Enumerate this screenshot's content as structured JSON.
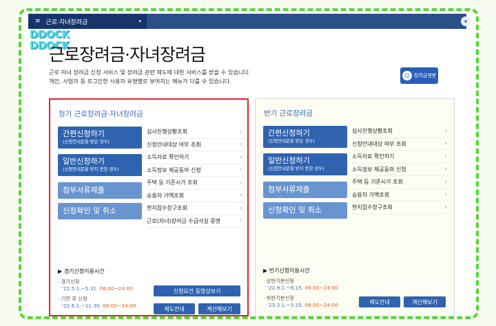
{
  "topbar": {
    "menu_icon": "≡",
    "selected": "근로·자녀장려금",
    "caret": "▾"
  },
  "logo": {
    "line1": "DDOCK",
    "line2": "DDOCK"
  },
  "page": {
    "title": "근로장려금·자녀장려금",
    "desc_line1": "근로·자녀 장려금 신청 서비스 및 장려금 관련 제도에 대한 서비스를 받을 수 있습니다.",
    "desc_line2": "개인, 사업자 등 로그인한 사용자 유형별로 보여지는 메뉴가 다를 수 있습니다."
  },
  "chatbot": {
    "label": "장려금챗봇"
  },
  "left": {
    "title": "정기 근로장려금·자녀장려금",
    "btn_simple": "간편신청하기",
    "btn_simple_sub": "(신청안내문을 받은 경우)",
    "btn_general": "일반신청하기",
    "btn_general_sub": "(신청안내문을 받지 못한 경우)",
    "btn_docs": "첨부서류제출",
    "btn_check": "신청확인 및 취소",
    "links": [
      "심사진행상황조회",
      "신청안내대상 여부 조회",
      "소득자료 확인하기",
      "소득정보 제공동의 신청",
      "주택 등 기준시가 조회",
      "승용차 가액조회",
      "현지접수창구조회",
      "근로(자녀)장려금 수급사실 증명"
    ],
    "usage_title": "▶ 경기신청이용시간",
    "u1_label": "· 경기신청",
    "u1_date": "'22.5.1.~5.31.",
    "u1_time": "06:00~24:00",
    "u2_label": "· 기한 후 신청",
    "u2_date": "'22.6.1.~11.30.",
    "u2_time": "06:00~24:00",
    "btn_video": "신청요건 동영상보기",
    "btn_guide": "제도안내",
    "btn_calc": "계산해보기"
  },
  "right": {
    "title": "반기 근로장려금",
    "btn_simple": "간편신청하기",
    "btn_simple_sub": "(신청안내문을 받은 경우)",
    "btn_general": "일반신청하기",
    "btn_general_sub": "(신청안내문을 받지 못한 경우)",
    "btn_docs": "첨부서류제출",
    "btn_check": "신청확인 및 취소",
    "links": [
      "심사진행상황조회",
      "신청안내대상 여부 조회",
      "소득자료 확인하기",
      "소득정보 제공동의 신청",
      "주택 등 기준시가 조회",
      "승용차 가액조회",
      "현지접수창구조회"
    ],
    "usage_title": "▶ 반기신청이용시간",
    "u1_label": "· 상반기분신청",
    "u1_date": "'22.9.1.~9.15.",
    "u1_time": "06:00~24:00",
    "u2_label": "· 하반기분신청",
    "u2_date": "'23.3.1.~3.15.",
    "u2_time": "06:00~24:00",
    "btn_guide": "제도안내",
    "btn_calc": "계산해보기"
  },
  "icons": {
    "arrow": "›",
    "chatbot_face": "☺"
  }
}
